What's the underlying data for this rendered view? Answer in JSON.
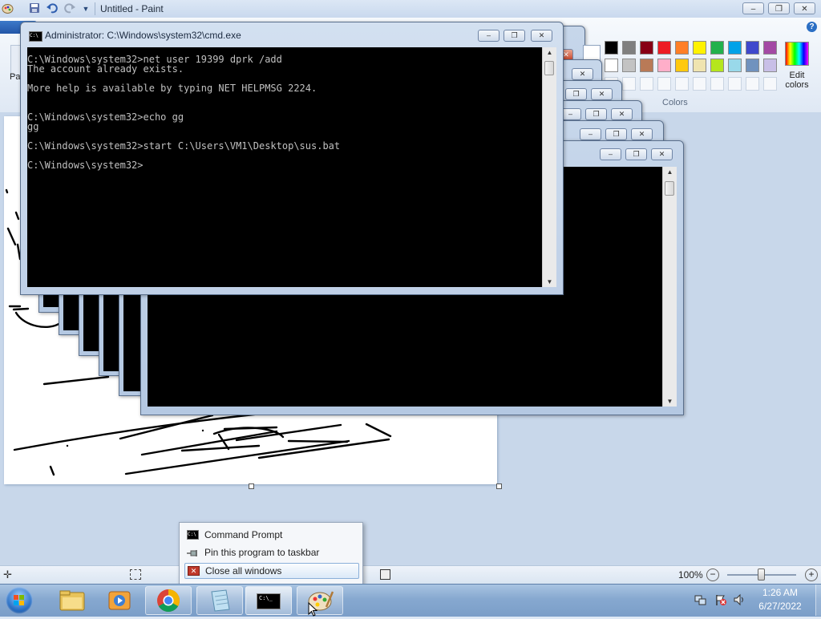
{
  "paint": {
    "title": "Untitled - Paint",
    "qat_arrow": "▼",
    "ribbon_tab_left": "Pa",
    "colors_label": "Colors",
    "edit_colors_line1": "Edit",
    "edit_colors_line2": "colors",
    "help_icon": "?",
    "zoom_text": "100%",
    "zoom_level": 1.0,
    "palette_row1": [
      "#000000",
      "#7f7f7f",
      "#880015",
      "#ed1c24",
      "#ff7f27",
      "#fff200",
      "#22b14c",
      "#00a2e8",
      "#3f48cc",
      "#a349a4"
    ],
    "palette_row2": [
      "#ffffff",
      "#c3c3c3",
      "#b97a57",
      "#ffaec9",
      "#ffc90e",
      "#efe4b0",
      "#b5e61d",
      "#99d9ea",
      "#7092be",
      "#c8bfe7"
    ]
  },
  "cmd": {
    "title": "Administrator: C:\\Windows\\system32\\cmd.exe",
    "icon_text": "C:\\",
    "lines": [
      "C:\\Windows\\system32>net user 19399 dprk /add",
      "The account already exists.",
      "",
      "More help is available by typing NET HELPMSG 2224.",
      "",
      "",
      "C:\\Windows\\system32>echo gg",
      "gg",
      "",
      "C:\\Windows\\system32>start C:\\Users\\VM1\\Desktop\\sus.bat",
      "",
      "C:\\Windows\\system32>"
    ]
  },
  "jumplist": {
    "items": [
      {
        "label": "Command Prompt",
        "icon": "cmd-icon"
      },
      {
        "label": "Pin this program to taskbar",
        "icon": "pin-icon"
      },
      {
        "label": "Close all windows",
        "icon": "close-icon"
      }
    ]
  },
  "taskbar": {
    "items": [
      {
        "name": "start-button",
        "icon": "windows-orb-icon"
      },
      {
        "name": "explorer",
        "icon": "folder-icon"
      },
      {
        "name": "media-player",
        "icon": "media-player-icon"
      },
      {
        "name": "chrome",
        "icon": "chrome-icon"
      },
      {
        "name": "notepad",
        "icon": "notepad-icon"
      },
      {
        "name": "cmd",
        "icon": "cmd-icon",
        "icon_text": "C:\\_"
      },
      {
        "name": "paint",
        "icon": "paint-icon"
      }
    ],
    "clock_time": "1:26 AM",
    "clock_date": "6/27/2022"
  }
}
